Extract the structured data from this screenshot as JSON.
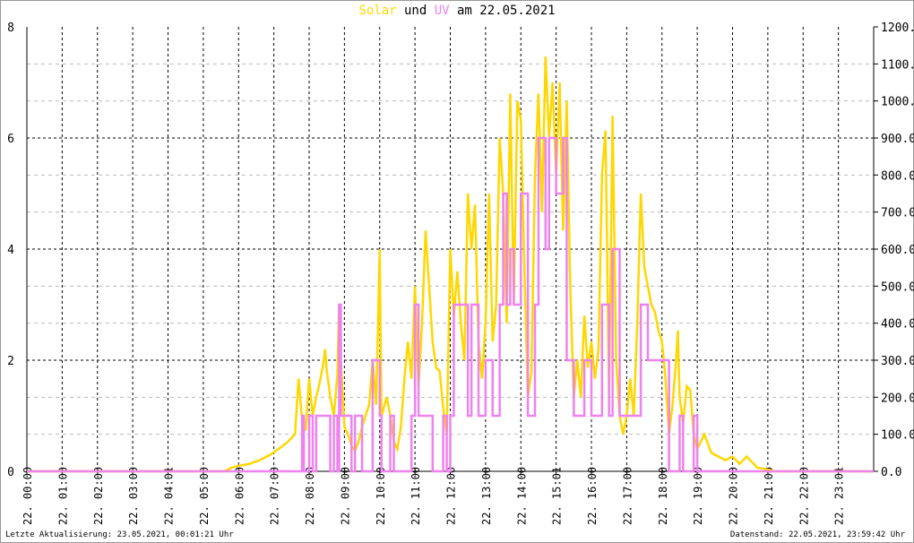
{
  "title": {
    "part1": "Solar",
    "part2": " und ",
    "part3": "UV",
    "part4": " am 22.05.2021"
  },
  "footer": {
    "left": "Letzte Aktualisierung: 23.05.2021, 00:01:21 Uhr",
    "right": "Datenstand: 22.05.2021, 23:59:42 Uhr"
  },
  "colors": {
    "solar": "#FFD700",
    "uv": "#EE82EE",
    "grid_major": "#000000",
    "grid_minor": "#bbbbbb"
  },
  "chart_data": {
    "type": "line",
    "title": "Solar und UV am 22.05.2021",
    "xlim": [
      0,
      24
    ],
    "x_tick_labels": [
      "22. 00:00",
      "22. 01:00",
      "22. 02:00",
      "22. 03:00",
      "22. 04:01",
      "22. 05:00",
      "22. 06:00",
      "22. 07:00",
      "22. 08:00",
      "22. 09:00",
      "22. 10:00",
      "22. 11:00",
      "22. 12:00",
      "22. 13:00",
      "22. 14:00",
      "22. 15:01",
      "22. 16:00",
      "22. 17:00",
      "22. 18:00",
      "22. 19:00",
      "22. 20:00",
      "22. 21:00",
      "22. 22:00",
      "22. 23:01"
    ],
    "y_left": {
      "label": "UV",
      "ylim": [
        0,
        8
      ],
      "ticks": [
        "0",
        "2",
        "4",
        "6",
        "8"
      ]
    },
    "y_right": {
      "label": "Solar",
      "ylim": [
        0,
        1200
      ],
      "ticks": [
        "0.0",
        "100.0",
        "200.0",
        "300.0",
        "400.0",
        "500.0",
        "600.0",
        "700.0",
        "800.0",
        "900.0",
        "1000.0",
        "1100.0",
        "1200.0"
      ]
    },
    "series": [
      {
        "name": "Solar",
        "axis": "right",
        "x": [
          0,
          5.6,
          5.8,
          6.0,
          6.3,
          6.6,
          6.9,
          7.2,
          7.4,
          7.6,
          7.7,
          7.8,
          7.9,
          8.0,
          8.1,
          8.2,
          8.3,
          8.4,
          8.45,
          8.5,
          8.6,
          8.7,
          8.8,
          8.85,
          8.9,
          9.0,
          9.1,
          9.2,
          9.3,
          9.4,
          9.5,
          9.6,
          9.7,
          9.8,
          9.9,
          10.0,
          10.05,
          10.2,
          10.3,
          10.4,
          10.5,
          10.6,
          10.7,
          10.8,
          10.9,
          11.0,
          11.1,
          11.2,
          11.3,
          11.4,
          11.5,
          11.6,
          11.7,
          11.8,
          11.9,
          12.0,
          12.1,
          12.2,
          12.3,
          12.4,
          12.5,
          12.6,
          12.7,
          12.8,
          12.9,
          13.0,
          13.1,
          13.2,
          13.3,
          13.4,
          13.5,
          13.6,
          13.7,
          13.8,
          13.9,
          14.0,
          14.1,
          14.2,
          14.3,
          14.4,
          14.5,
          14.6,
          14.7,
          14.8,
          14.9,
          15.0,
          15.1,
          15.2,
          15.3,
          15.4,
          15.5,
          15.6,
          15.7,
          15.8,
          15.9,
          16.0,
          16.1,
          16.2,
          16.3,
          16.4,
          16.5,
          16.6,
          16.7,
          16.8,
          16.9,
          17.0,
          17.1,
          17.2,
          17.3,
          17.4,
          17.5,
          17.6,
          17.7,
          17.8,
          17.9,
          18.0,
          18.1,
          18.2,
          18.3,
          18.4,
          18.45,
          18.5,
          18.6,
          18.7,
          18.8,
          18.9,
          19.0,
          19.2,
          19.4,
          19.6,
          19.8,
          20.0,
          20.2,
          20.4,
          20.5,
          20.7,
          21.0,
          21.2,
          24
        ],
        "values": [
          0,
          0,
          10,
          15,
          20,
          30,
          45,
          65,
          80,
          100,
          250,
          140,
          110,
          250,
          150,
          200,
          240,
          290,
          330,
          270,
          200,
          150,
          260,
          450,
          300,
          120,
          100,
          70,
          55,
          80,
          120,
          150,
          180,
          300,
          180,
          600,
          150,
          200,
          150,
          80,
          60,
          120,
          250,
          350,
          250,
          500,
          230,
          400,
          650,
          500,
          350,
          280,
          270,
          170,
          100,
          600,
          420,
          540,
          400,
          300,
          750,
          600,
          720,
          350,
          250,
          400,
          750,
          350,
          450,
          900,
          750,
          400,
          1020,
          450,
          1000,
          950,
          550,
          200,
          270,
          800,
          1020,
          700,
          1120,
          900,
          1050,
          800,
          1050,
          650,
          1000,
          500,
          200,
          300,
          200,
          420,
          280,
          350,
          250,
          330,
          800,
          920,
          200,
          960,
          300,
          150,
          100,
          150,
          250,
          150,
          400,
          750,
          550,
          500,
          450,
          430,
          380,
          350,
          250,
          100,
          180,
          300,
          380,
          200,
          130,
          230,
          220,
          100,
          60,
          100,
          50,
          40,
          30,
          40,
          20,
          40,
          30,
          10,
          5,
          0,
          0
        ]
      },
      {
        "name": "UV",
        "axis": "left",
        "step": true,
        "x": [
          0,
          7.8,
          7.85,
          8.0,
          8.1,
          8.2,
          8.6,
          8.7,
          8.8,
          8.85,
          8.9,
          9.2,
          9.3,
          9.5,
          9.8,
          10.0,
          10.05,
          10.3,
          10.4,
          10.9,
          11.0,
          11.1,
          11.5,
          11.8,
          11.9,
          12.0,
          12.1,
          12.5,
          12.6,
          12.8,
          13.0,
          13.2,
          13.4,
          13.5,
          13.6,
          13.7,
          13.8,
          14.0,
          14.2,
          14.4,
          14.5,
          14.7,
          14.8,
          15.0,
          15.2,
          15.3,
          15.5,
          15.8,
          16.0,
          16.3,
          16.5,
          16.6,
          16.8,
          17.0,
          17.4,
          17.6,
          17.8,
          18.0,
          18.2,
          18.5,
          18.6,
          18.9,
          19.0,
          24
        ],
        "values": [
          0,
          1,
          0,
          1,
          0,
          1,
          0,
          1,
          0,
          3,
          1,
          0,
          1,
          0,
          2,
          1,
          0,
          1,
          0,
          1,
          3,
          1,
          0,
          1,
          0,
          1,
          3,
          1,
          3,
          1,
          2,
          1,
          3,
          5,
          3,
          4,
          3,
          5,
          1,
          3,
          6,
          4,
          6,
          5,
          6,
          2,
          1,
          2,
          1,
          3,
          1,
          4,
          1,
          1,
          3,
          2,
          2,
          2,
          0,
          1,
          0,
          1,
          0,
          0
        ]
      }
    ]
  }
}
